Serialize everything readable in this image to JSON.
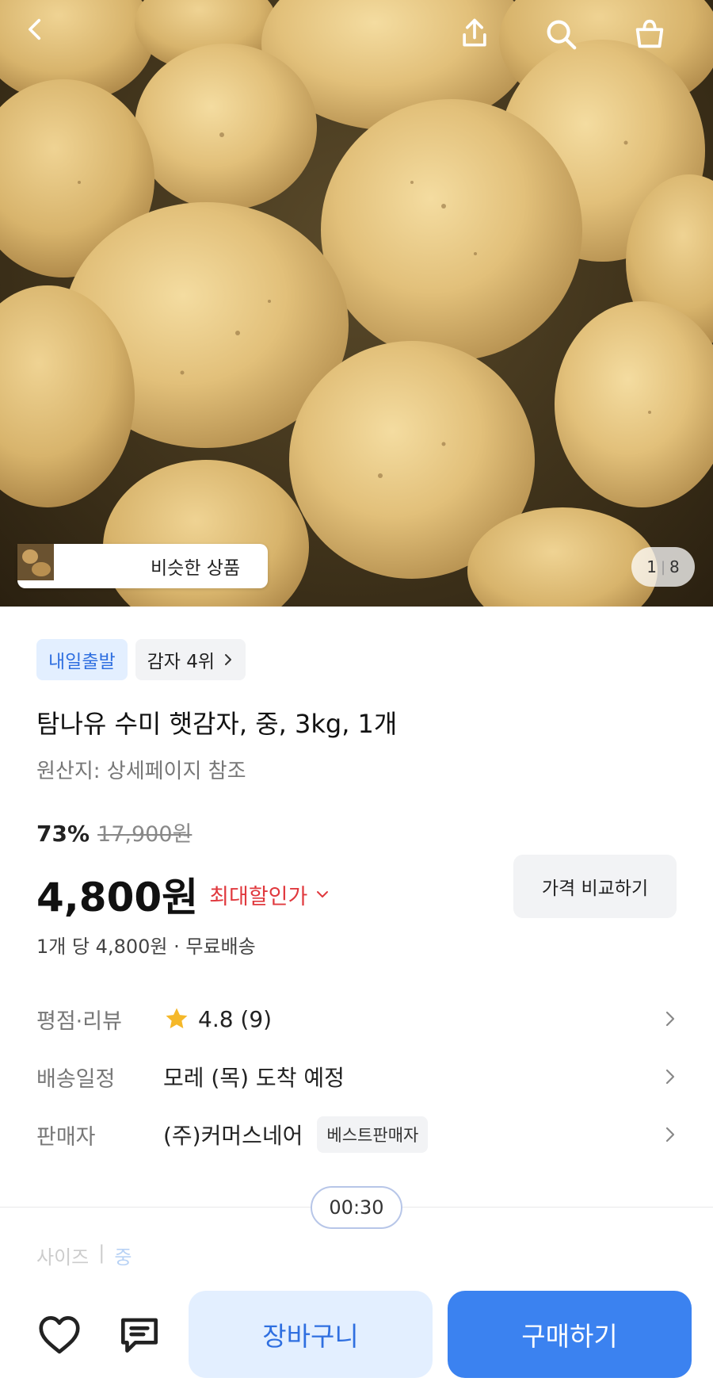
{
  "header": {
    "back_icon": "back-arrow-icon",
    "share_icon": "share-icon",
    "search_icon": "search-icon",
    "cart_icon": "shopping-bag-icon"
  },
  "gallery": {
    "similar_label": "비슷한 상품",
    "page_current": "1",
    "page_separator": "|",
    "page_total": "8"
  },
  "badges": {
    "shipping": "내일출발",
    "rank": "감자 4위"
  },
  "product": {
    "title": "탐나유 수미 햇감자, 중, 3kg, 1개",
    "origin": "원산지: 상세페이지 참조",
    "discount": "73%",
    "original_price": "17,900원",
    "price": "4,800원",
    "price_tag": "최대할인가",
    "compare_label": "가격 비교하기",
    "unit_price": "1개 당 4,800원 · 무료배송"
  },
  "info": {
    "rating_label": "평점·리뷰",
    "rating_value": "4.8 (9)",
    "delivery_label": "배송일정",
    "delivery_value": "모레 (목) 도착 예정",
    "seller_label": "판매자",
    "seller_value": "(주)커머스네어",
    "seller_badge": "베스트판매자"
  },
  "timer": "00:30",
  "size": {
    "label": "사이즈",
    "separator": "|",
    "value": "중"
  },
  "bottom": {
    "cart_label": "장바구니",
    "buy_label": "구매하기"
  },
  "colors": {
    "accent": "#3b82f0",
    "accent_light": "#e3efff",
    "discount_red": "#e0393e",
    "star": "#f5b829"
  }
}
